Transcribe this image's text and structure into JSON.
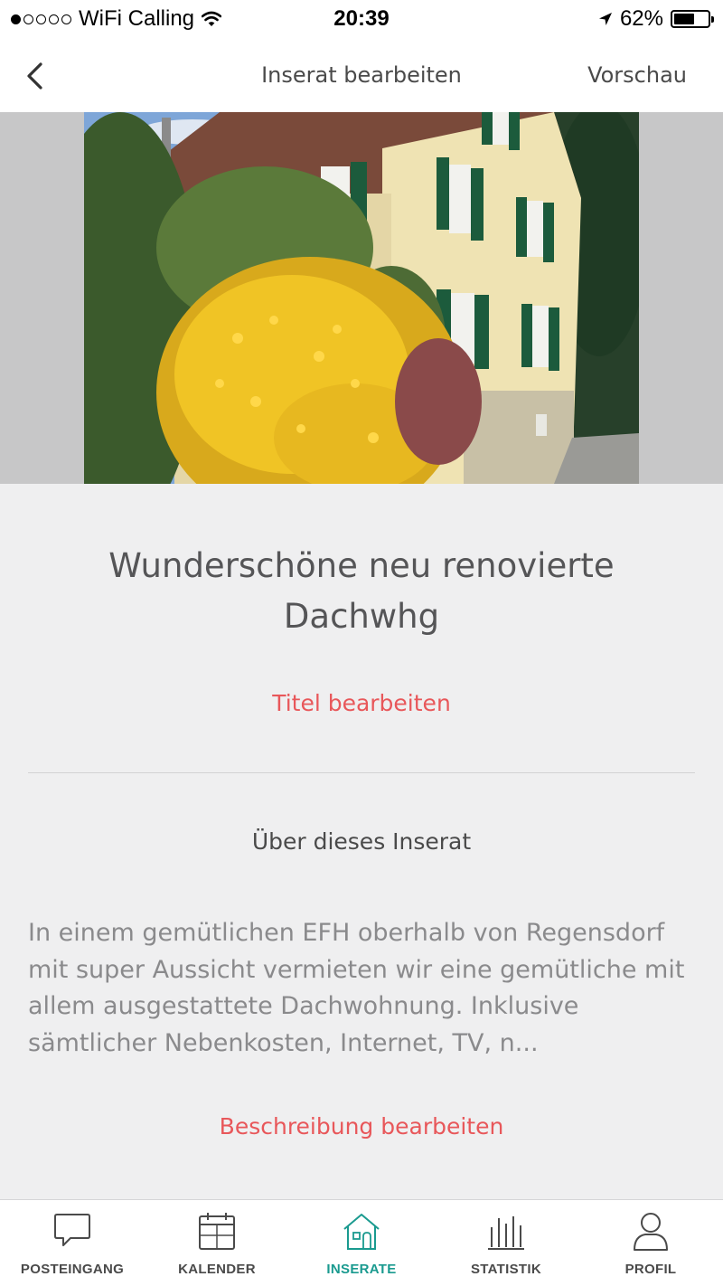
{
  "status_bar": {
    "carrier": "WiFi Calling",
    "time": "20:39",
    "battery": "62%",
    "battery_level": 0.62,
    "icons": [
      "signal-dots-icon",
      "wifi-icon",
      "location-arrow-icon",
      "battery-icon"
    ]
  },
  "nav": {
    "back_icon": "chevron-left-icon",
    "title": "Inserat bearbeiten",
    "action": "Vorschau"
  },
  "hero": {
    "image": "house-photo"
  },
  "listing": {
    "title": "Wunderschöne neu renovierte Dachwhg",
    "edit_title": "Titel bearbeiten",
    "section_heading": "Über dieses Inserat",
    "description": "In einem gemütlichen EFH oberhalb von Regensdorf mit super Aussicht vermieten wir eine gemütliche mit allem ausgestattete Dachwohnung. Inklusive sämtlicher Nebenkosten, Internet, TV, n...",
    "edit_description": "Beschreibung bearbeiten"
  },
  "tabs": [
    {
      "label": "POSTEINGANG",
      "icon": "chat-bubble-icon",
      "active": false
    },
    {
      "label": "KALENDER",
      "icon": "calendar-icon",
      "active": false
    },
    {
      "label": "INSERATE",
      "icon": "house-icon",
      "active": true
    },
    {
      "label": "STATISTIK",
      "icon": "bar-chart-icon",
      "active": false
    },
    {
      "label": "PROFIL",
      "icon": "person-icon",
      "active": false
    }
  ],
  "colors": {
    "accent_red": "#e8575a",
    "accent_teal": "#1a9a8f",
    "background": "#efeff0"
  }
}
